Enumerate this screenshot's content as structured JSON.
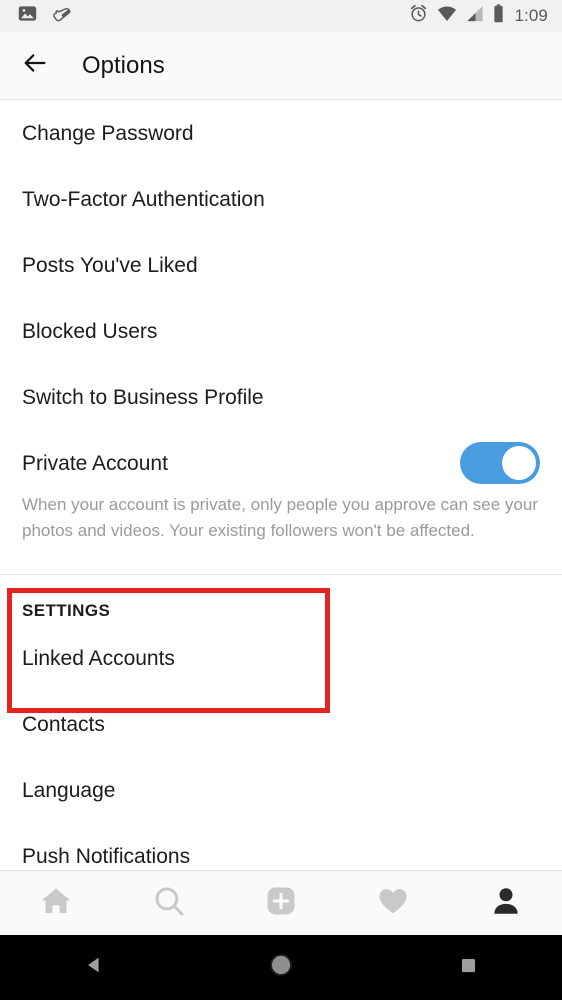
{
  "status_bar": {
    "icons_left": [
      "photo-icon",
      "shoe-icon"
    ],
    "icons_right": [
      "alarm-icon",
      "wifi-icon",
      "cellular-signal-icon",
      "battery-icon"
    ],
    "time": "1:09"
  },
  "header": {
    "back_icon": "back-arrow-icon",
    "title": "Options"
  },
  "account_section": {
    "items": [
      {
        "label": "Change Password"
      },
      {
        "label": "Two-Factor Authentication"
      },
      {
        "label": "Posts You've Liked"
      },
      {
        "label": "Blocked Users"
      },
      {
        "label": "Switch to Business Profile"
      }
    ],
    "private_account": {
      "label": "Private Account",
      "toggle_on": true,
      "description": "When your account is private, only people you approve can see your photos and videos. Your existing followers won't be affected."
    }
  },
  "settings_section": {
    "header": "SETTINGS",
    "items": [
      {
        "label": "Linked Accounts"
      },
      {
        "label": "Contacts"
      },
      {
        "label": "Language"
      },
      {
        "label": "Push Notifications"
      }
    ]
  },
  "highlight": {
    "color": "#e2231f",
    "target": "settings-section-linked-accounts"
  },
  "bottom_nav": {
    "items": [
      {
        "name": "home-icon",
        "active": false
      },
      {
        "name": "search-icon",
        "active": false
      },
      {
        "name": "add-post-icon",
        "active": false
      },
      {
        "name": "activity-heart-icon",
        "active": false
      },
      {
        "name": "profile-icon",
        "active": true
      }
    ]
  },
  "android_nav": {
    "buttons": [
      {
        "name": "android-back-button"
      },
      {
        "name": "android-home-button"
      },
      {
        "name": "android-recents-button"
      }
    ]
  },
  "colors": {
    "toggle_on": "#4a9ce0",
    "highlight_red": "#e2231f",
    "text_primary": "#1c1c1c",
    "text_secondary": "#9a9a9a"
  }
}
